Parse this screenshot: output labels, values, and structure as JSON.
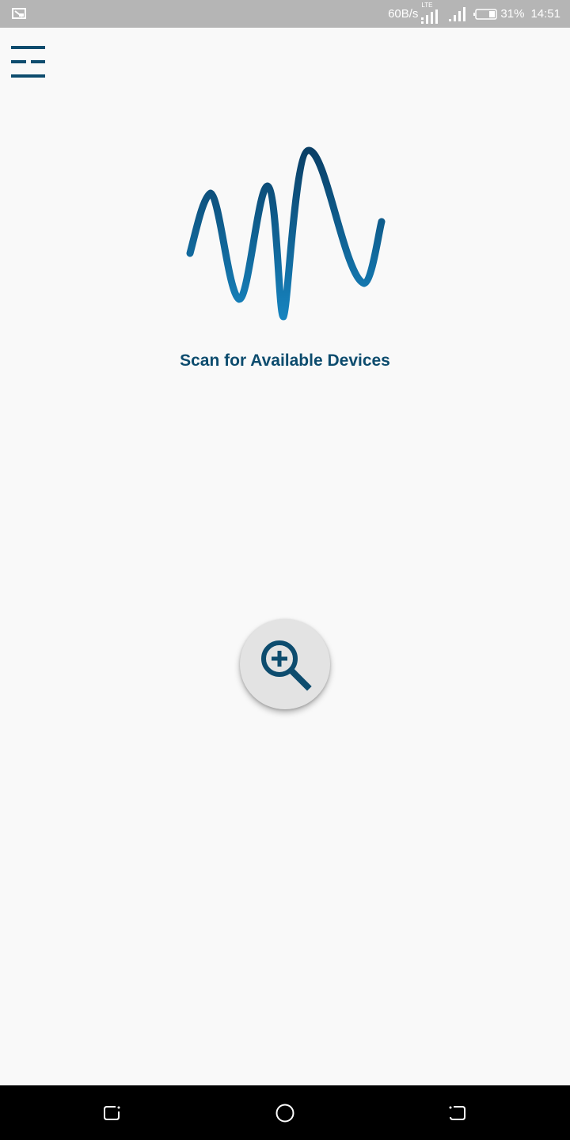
{
  "status_bar": {
    "data_rate": "60B/s",
    "network_type": "LTE",
    "battery_percent": "31%",
    "time": "14:51",
    "icons": [
      "screencast-icon",
      "lte-signal-icon",
      "signal-icon",
      "battery-icon"
    ]
  },
  "app": {
    "menu_icon": "menu-icon",
    "logo_icon": "waveform-logo-icon",
    "title": "Scan for Available Devices",
    "scan_button_icon": "zoom-in-search-icon"
  },
  "nav_bar": {
    "icons": [
      "recent-apps-icon",
      "home-icon",
      "back-icon"
    ]
  },
  "colors": {
    "accent": "#0d4c6e",
    "status_bar_bg": "#b5b5b5",
    "background": "#f9f9f9",
    "fab_bg": "#e3e3e3",
    "nav_bar_bg": "#000000"
  }
}
